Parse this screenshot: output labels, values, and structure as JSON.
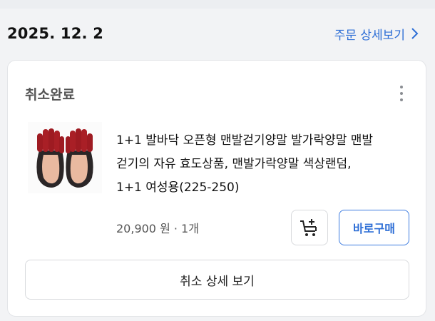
{
  "order": {
    "date": "2025. 12. 2",
    "detail_link_label": "주문 상세보기"
  },
  "card": {
    "status": "취소완료",
    "product": {
      "name": "1+1 발바닥 오픈형 맨발걷기양말 발가락양말 맨발\n걷기의 자유 효도상품, 맨발가락양말 색상랜덤,\n1+1 여성용(225-250)",
      "price_line": "20,900 원 · 1개",
      "image_icon": "toe-socks-product-image"
    },
    "buttons": {
      "add_to_cart_icon": "add-to-cart-icon",
      "buy_now_label": "바로구매",
      "cancel_detail_label": "취소 상세 보기"
    }
  },
  "colors": {
    "link_blue": "#2f6fd6",
    "status_gray": "#555555",
    "sock_red": "#9e1b22"
  }
}
